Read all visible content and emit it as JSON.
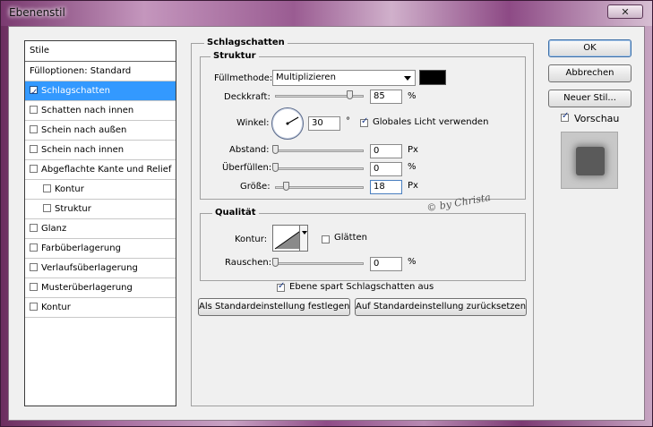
{
  "window": {
    "title": "Ebenenstil",
    "close_label": "✕"
  },
  "styles_panel": {
    "header": "Stile",
    "items": [
      {
        "label": "Fülloptionen: Standard",
        "checkbox": false,
        "checked": false,
        "indent": false,
        "selected": false
      },
      {
        "label": "Schlagschatten",
        "checkbox": true,
        "checked": true,
        "indent": false,
        "selected": true
      },
      {
        "label": "Schatten nach innen",
        "checkbox": true,
        "checked": false,
        "indent": false,
        "selected": false
      },
      {
        "label": "Schein nach außen",
        "checkbox": true,
        "checked": false,
        "indent": false,
        "selected": false
      },
      {
        "label": "Schein nach innen",
        "checkbox": true,
        "checked": false,
        "indent": false,
        "selected": false
      },
      {
        "label": "Abgeflachte Kante und Relief",
        "checkbox": true,
        "checked": false,
        "indent": false,
        "selected": false
      },
      {
        "label": "Kontur",
        "checkbox": true,
        "checked": false,
        "indent": true,
        "selected": false
      },
      {
        "label": "Struktur",
        "checkbox": true,
        "checked": false,
        "indent": true,
        "selected": false
      },
      {
        "label": "Glanz",
        "checkbox": true,
        "checked": false,
        "indent": false,
        "selected": false
      },
      {
        "label": "Farbüberlagerung",
        "checkbox": true,
        "checked": false,
        "indent": false,
        "selected": false
      },
      {
        "label": "Verlaufsüberlagerung",
        "checkbox": true,
        "checked": false,
        "indent": false,
        "selected": false
      },
      {
        "label": "Musterüberlagerung",
        "checkbox": true,
        "checked": false,
        "indent": false,
        "selected": false
      },
      {
        "label": "Kontur",
        "checkbox": true,
        "checked": false,
        "indent": false,
        "selected": false
      }
    ]
  },
  "section": {
    "title": "Schlagschatten",
    "structure": {
      "title": "Struktur",
      "blend_mode_label": "Füllmethode:",
      "blend_mode_value": "Multiplizieren",
      "shadow_color": "#000000",
      "opacity_label": "Deckkraft:",
      "opacity_value": "85",
      "opacity_unit": "%",
      "opacity_fraction": 0.85,
      "angle_label": "Winkel:",
      "angle_value": "30",
      "angle_unit": "°",
      "angle_degrees": 30,
      "global_light_label": "Globales Licht verwenden",
      "global_light_checked": true,
      "distance_label": "Abstand:",
      "distance_value": "0",
      "distance_unit": "Px",
      "spread_label": "Überfüllen:",
      "spread_value": "0",
      "spread_unit": "%",
      "size_label": "Größe:",
      "size_value": "18",
      "size_unit": "Px"
    },
    "quality": {
      "title": "Qualität",
      "contour_label": "Kontur:",
      "antialias_label": "Glätten",
      "antialias_checked": false,
      "noise_label": "Rauschen:",
      "noise_value": "0",
      "noise_unit": "%"
    },
    "knockout_label": "Ebene spart Schlagschatten aus",
    "knockout_checked": true,
    "make_default_label": "Als Standardeinstellung festlegen",
    "reset_default_label": "Auf Standardeinstellung zurücksetzen"
  },
  "watermark": "© by Christa",
  "actions": {
    "ok_label": "OK",
    "cancel_label": "Abbrechen",
    "new_style_label": "Neuer Stil...",
    "preview_label": "Vorschau",
    "preview_checked": true
  }
}
